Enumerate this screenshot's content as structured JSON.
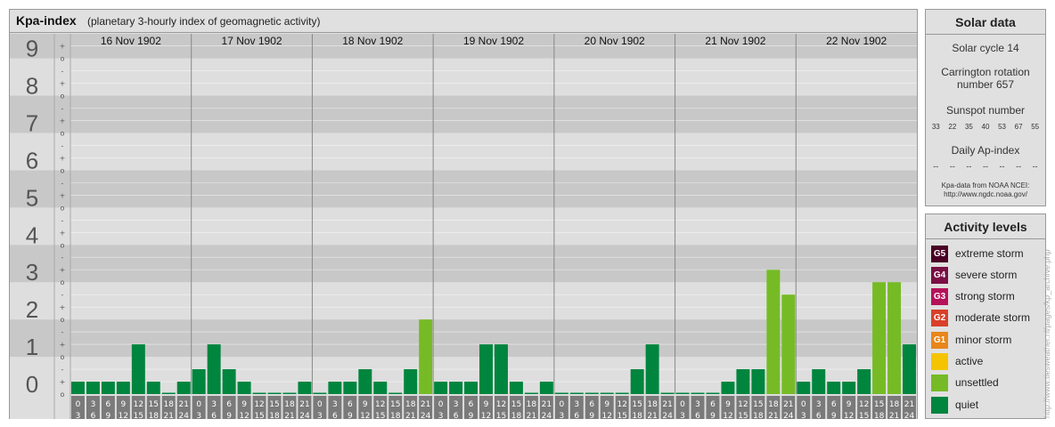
{
  "header": {
    "title": "Kpa-index",
    "subtitle": "(planetary 3-hourly index of geomagnetic activity)"
  },
  "chart_data": {
    "type": "bar",
    "title": "Kpa-index",
    "subtitle": "(planetary 3-hourly index of geomagnetic activity)",
    "ylim": [
      0,
      9
    ],
    "y_ticks": [
      "0",
      "1",
      "2",
      "3",
      "4",
      "5",
      "6",
      "7",
      "8",
      "9"
    ],
    "thirds_labels": [
      "+",
      "o",
      "-"
    ],
    "grid": true,
    "days": [
      "16 Nov 1902",
      "17 Nov 1902",
      "18 Nov 1902",
      "19 Nov 1902",
      "20 Nov 1902",
      "21 Nov 1902",
      "22 Nov 1902"
    ],
    "interval_start": [
      "0",
      "3",
      "6",
      "9",
      "12",
      "15",
      "18",
      "21"
    ],
    "interval_end": [
      "3",
      "6",
      "9",
      "12",
      "15",
      "18",
      "21",
      "24"
    ],
    "values": [
      [
        0.333,
        0.333,
        0.333,
        0.333,
        1.333,
        0.333,
        0,
        0.333
      ],
      [
        0.667,
        1.333,
        0.667,
        0.333,
        0,
        0,
        0,
        0.333
      ],
      [
        0,
        0.333,
        0.333,
        0.667,
        0.333,
        0,
        0.667,
        2
      ],
      [
        0.333,
        0.333,
        0.333,
        1.333,
        1.333,
        0.333,
        0,
        0.333
      ],
      [
        0,
        0,
        0,
        0,
        0,
        0.667,
        1.333,
        0
      ],
      [
        0,
        0,
        0,
        0.333,
        0.667,
        0.667,
        3.333,
        2.667
      ],
      [
        0.333,
        0.667,
        0.333,
        0.333,
        0.667,
        3,
        3,
        1.333
      ]
    ],
    "colors": {
      "quiet": "#00853e",
      "unsettled": "#76bb26",
      "active": "#f5c400",
      "minor": "#e8861a",
      "moderate": "#d8402a",
      "strong": "#b5125a",
      "severe": "#7a0f45",
      "extreme": "#4a0025",
      "band_dark": "#c8c8c8",
      "band_light": "#dedede"
    }
  },
  "solar": {
    "title": "Solar data",
    "solar_cycle": "Solar cycle 14",
    "carrington": "Carrington rotation number 657",
    "sunspot_label": "Sunspot number",
    "sunspot_values": [
      "33",
      "22",
      "35",
      "40",
      "53",
      "67",
      "55"
    ],
    "ap_label": "Daily Ap-index",
    "ap_values": [
      "--",
      "--",
      "--",
      "--",
      "--",
      "--",
      "--"
    ],
    "source_line1": "Kpa-data from NOAA NCEI:",
    "source_line2": "http://www.ngdc.noaa.gov/"
  },
  "activity": {
    "title": "Activity levels",
    "levels": [
      {
        "badge": "G5",
        "label": "extreme storm",
        "color": "#4a0025"
      },
      {
        "badge": "G4",
        "label": "severe storm",
        "color": "#7a0f45"
      },
      {
        "badge": "G3",
        "label": "strong storm",
        "color": "#b5125a"
      },
      {
        "badge": "G2",
        "label": "moderate storm",
        "color": "#d8402a"
      },
      {
        "badge": "G1",
        "label": "minor storm",
        "color": "#e8861a"
      },
      {
        "badge": "",
        "label": "active",
        "color": "#f5c400"
      },
      {
        "badge": "",
        "label": "unsettled",
        "color": "#76bb26"
      },
      {
        "badge": "",
        "label": "quiet",
        "color": "#00853e"
      }
    ]
  },
  "watermark": "http://www.tiesweather.nl/pages/kp_archive.php"
}
